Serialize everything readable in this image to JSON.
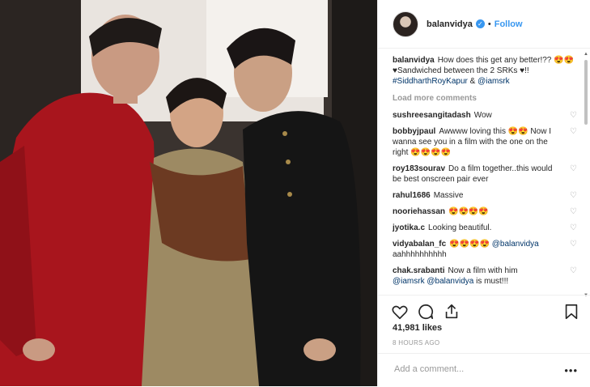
{
  "post": {
    "username": "balanvidya",
    "follow_label": "Follow",
    "separator": "•"
  },
  "caption": {
    "user": "balanvidya",
    "text": "How does this get any better!?? 😍😍",
    "line2": "♥Sandwiched between the 2 SRKs ♥!!",
    "tag1": "#SiddharthRoyKapur",
    "amp": "&",
    "tag2": "@iamsrk"
  },
  "load_more": "Load more comments",
  "comments": [
    {
      "user": "sushreesangitadash",
      "text": "Wow"
    },
    {
      "user": "bobbyjpaul",
      "text": "Awwww loving this 😍😍 Now I wanna see you in a film with the one on the right 😍😍😍😍"
    },
    {
      "user": "roy183sourav",
      "text": "Do a film together..this would be best onscreen pair ever"
    },
    {
      "user": "rahul1686",
      "text": "Massive"
    },
    {
      "user": "noorieh­assan",
      "text": "😍😍😍😍"
    },
    {
      "user": "jyotika.c",
      "text": "Looking beautiful."
    },
    {
      "user": "vidyabalan_fc",
      "text": "😍😍😍😍",
      "mention": "@balanvidya",
      "tail": "aahhhhhhhhhh"
    },
    {
      "user": "chak.srabanti",
      "text": "Now a film with him",
      "mention": "@iamsrk @balanvidya",
      "tail": "is must!!!"
    }
  ],
  "likes": "41,981 likes",
  "time_ago": "8 HOURS AGO",
  "add_comment_placeholder": "Add a comment...",
  "more_glyph": "•••",
  "heart_glyph": "♡",
  "icons": [
    "heart-icon",
    "comment-icon",
    "share-icon",
    "bookmark-icon",
    "verified-icon"
  ],
  "colors": {
    "accent": "#3897f0",
    "link": "#003569",
    "muted": "#999999"
  }
}
